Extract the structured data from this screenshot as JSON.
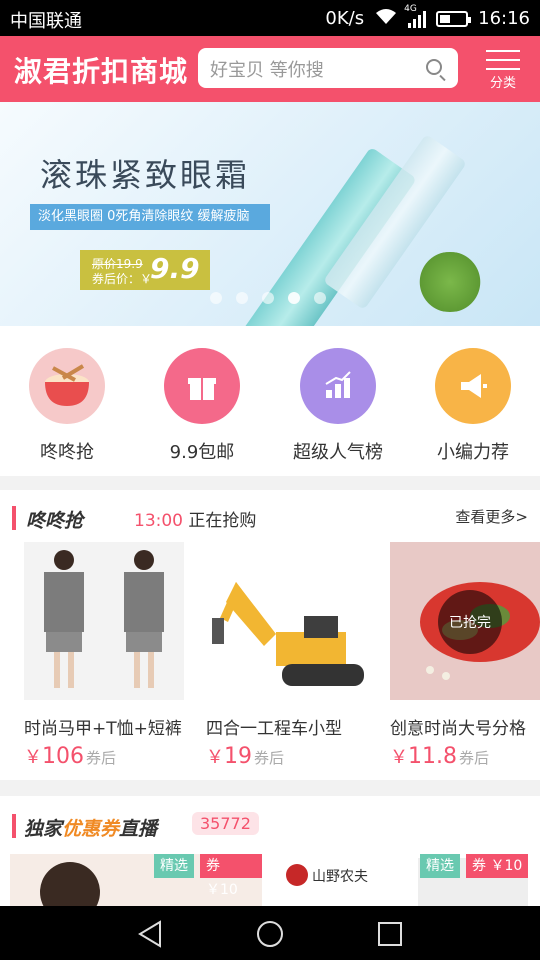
{
  "status": {
    "carrier": "中国联通",
    "speed": "0K/s",
    "network": "4G",
    "time": "16:16"
  },
  "header": {
    "logo": "淑君折扣商城",
    "search_placeholder": "好宝贝 等你搜",
    "category_label": "分类"
  },
  "banner": {
    "title": "滚珠紧致眼霜",
    "subtitle": "淡化黑眼圈 0死角清除眼纹 缓解疲脑",
    "original_price": "原价19.9",
    "after_label": "券后价：￥",
    "after_price": "9.9",
    "slide_count": 5,
    "active_slide": 4
  },
  "nav": [
    {
      "label": "咚咚抢",
      "icon": "drum-icon",
      "color": "#f6c9c9"
    },
    {
      "label": "9.9包邮",
      "icon": "gift-icon",
      "color": "#f4698a"
    },
    {
      "label": "超级人气榜",
      "icon": "chart-up-icon",
      "color": "#a98ee8"
    },
    {
      "label": "小编力荐",
      "icon": "megaphone-icon",
      "color": "#f8b447"
    }
  ],
  "flash": {
    "title": "咚咚抢",
    "time": "13:00",
    "status": "正在抢购",
    "more": "查看更多>",
    "products": [
      {
        "name": "时尚马甲+T恤+短裤",
        "currency": "￥",
        "price": "106",
        "suffix": "券后"
      },
      {
        "name": "四合一工程车小型",
        "currency": "￥",
        "price": "19",
        "suffix": "券后"
      },
      {
        "name": "创意时尚大号分格",
        "currency": "￥",
        "price": "11.8",
        "suffix": "券后",
        "sold_out": "已抢完"
      }
    ]
  },
  "coupon": {
    "title_a": "独家",
    "title_b": "优惠券",
    "title_c": "直播",
    "count": "35772",
    "cards": [
      {
        "tag": "精选",
        "coupon": "券 ￥10"
      },
      {
        "tag": "精选",
        "coupon": "券 ￥10",
        "brand": "山野农夫"
      }
    ]
  }
}
